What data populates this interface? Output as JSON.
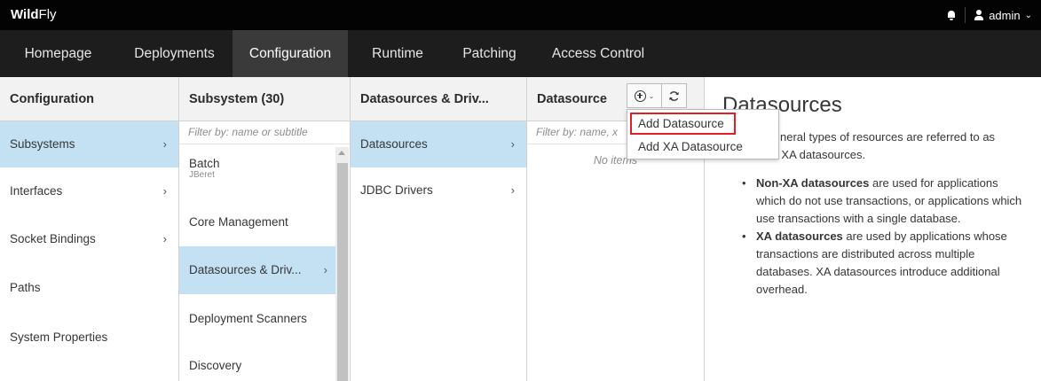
{
  "header": {
    "brand_bold": "Wild",
    "brand_light": "Fly",
    "user": "admin"
  },
  "nav": {
    "items": [
      "Homepage",
      "Deployments",
      "Configuration",
      "Runtime",
      "Patching",
      "Access Control"
    ],
    "active": "Configuration"
  },
  "columns": {
    "configuration": {
      "title": "Configuration",
      "items": [
        "Subsystems",
        "Interfaces",
        "Socket Bindings",
        "Paths",
        "System Properties"
      ],
      "selected": "Subsystems"
    },
    "subsystem": {
      "title": "Subsystem (30)",
      "filter_placeholder": "Filter by: name or subtitle",
      "items": [
        {
          "label": "Batch",
          "subtitle": "JBeret"
        },
        {
          "label": "Core Management"
        },
        {
          "label": "Datasources & Driv..."
        },
        {
          "label": "Deployment Scanners"
        },
        {
          "label": "Discovery"
        }
      ],
      "selected": "Datasources & Driv..."
    },
    "datasources_drivers": {
      "title": "Datasources & Driv...",
      "items": [
        "Datasources",
        "JDBC Drivers"
      ],
      "selected": "Datasources"
    },
    "datasource": {
      "title": "Datasource",
      "filter_placeholder": "Filter by: name, x",
      "empty_text": "No items"
    }
  },
  "dropdown": {
    "items": [
      "Add Datasource",
      "Add XA Datasource"
    ],
    "highlighted": "Add Datasource"
  },
  "description": {
    "title": "Datasources",
    "intro_visible": "neral types of resources are referred to as",
    "intro_line2": "s and XA datasources.",
    "bullets": [
      {
        "bold": "Non-XA datasources",
        "text": " are used for applications which do not use transactions, or applications which use transactions with a single database."
      },
      {
        "bold": "XA datasources",
        "text": " are used by applications whose transactions are distributed across multiple databases. XA datasources introduce additional overhead."
      }
    ]
  },
  "icons": [
    "bell-icon",
    "user-icon",
    "chevron-right-icon",
    "add-circle-icon",
    "refresh-icon"
  ],
  "colors": {
    "topbar": "#030303",
    "navbar": "#1d1d1d",
    "nav_active": "#3a3a3a",
    "selected_row": "#c4e1f4",
    "highlight_border": "#e01f25"
  }
}
